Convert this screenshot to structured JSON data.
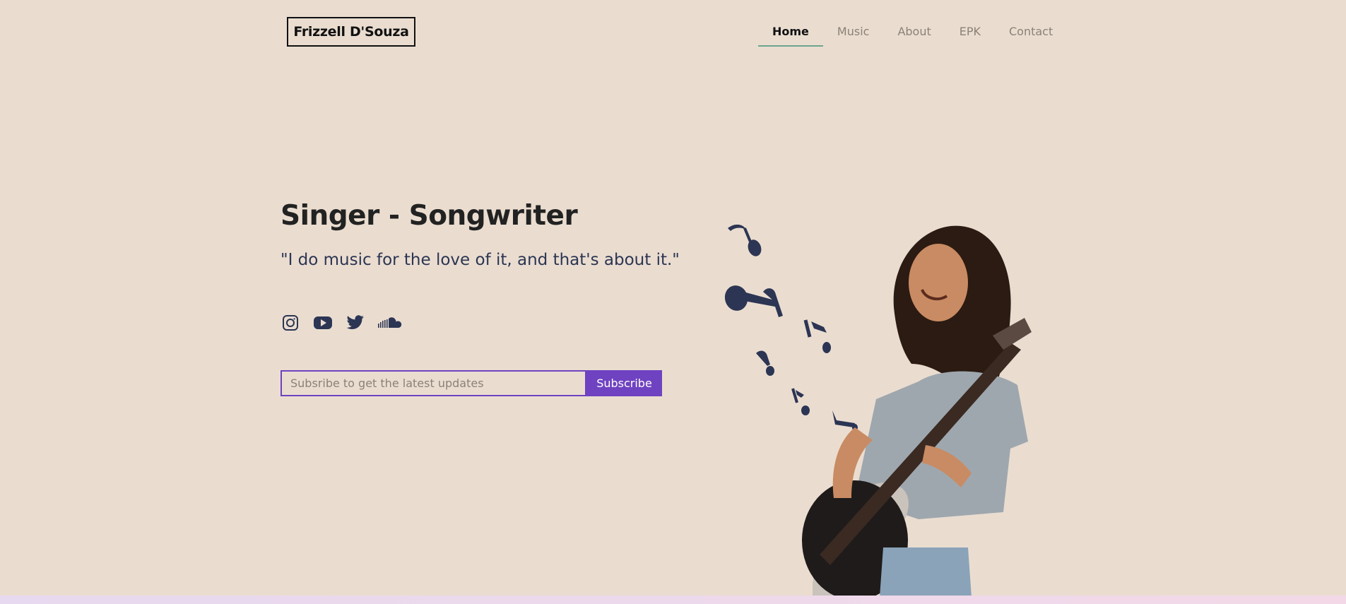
{
  "header": {
    "brand": "Frizzell D'Souza",
    "nav": [
      {
        "label": "Home",
        "active": true
      },
      {
        "label": "Music",
        "active": false
      },
      {
        "label": "About",
        "active": false
      },
      {
        "label": "EPK",
        "active": false
      },
      {
        "label": "Contact",
        "active": false
      }
    ]
  },
  "hero": {
    "title": "Singer - Songwriter",
    "quote": "\"I do music for the love of it, and that's about it.\"",
    "social_icons": [
      "instagram-icon",
      "youtube-icon",
      "twitter-icon",
      "soundcloud-icon"
    ],
    "subscribe": {
      "placeholder": "Subsribe to get the latest updates",
      "button_label": "Subscribe"
    }
  },
  "colors": {
    "background": "#eaddd0",
    "accent": "#6f42c1",
    "nav_underline": "#6aa58d",
    "icon": "#2c3553"
  }
}
